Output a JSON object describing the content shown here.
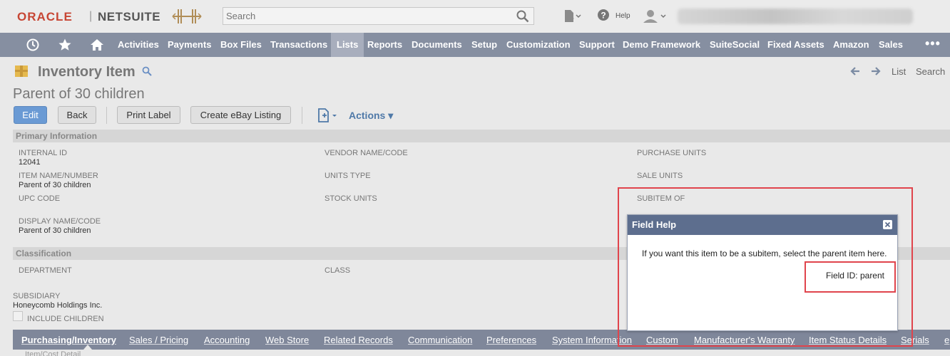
{
  "header": {
    "logo_oracle": "ORACLE",
    "logo_sep": "|",
    "logo_netsuite": "NETSUITE",
    "search_placeholder": "Search",
    "help_label": "Help"
  },
  "nav": {
    "items": [
      "Activities",
      "Payments",
      "Box Files",
      "Transactions",
      "Lists",
      "Reports",
      "Documents",
      "Setup",
      "Customization",
      "Support",
      "Demo Framework",
      "SuiteSocial",
      "Fixed Assets",
      "Amazon",
      "Sales"
    ],
    "active": "Lists",
    "more": "•••"
  },
  "page": {
    "title": "Inventory Item",
    "record_name": "Parent of 30 children",
    "pager_list": "List",
    "pager_search": "Search"
  },
  "buttons": {
    "edit": "Edit",
    "back": "Back",
    "print_label": "Print Label",
    "create_ebay": "Create eBay Listing",
    "actions": "Actions ▾"
  },
  "sections": {
    "primary": "Primary Information",
    "classification": "Classification"
  },
  "fields": {
    "internal_id_label": "INTERNAL ID",
    "internal_id_value": "12041",
    "item_name_label": "ITEM NAME/NUMBER",
    "item_name_value": "Parent of 30 children",
    "upc_label": "UPC CODE",
    "display_name_label": "DISPLAY NAME/CODE",
    "display_name_value": "Parent of 30 children",
    "vendor_label": "VENDOR NAME/CODE",
    "units_type_label": "UNITS TYPE",
    "stock_units_label": "STOCK UNITS",
    "purchase_units_label": "PURCHASE UNITS",
    "sale_units_label": "SALE UNITS",
    "subitem_label": "SUBITEM OF",
    "department_label": "DEPARTMENT",
    "class_label": "CLASS",
    "subsidiary_label": "SUBSIDIARY",
    "subsidiary_value": "Honeycomb Holdings Inc.",
    "include_children_label": "INCLUDE CHILDREN"
  },
  "tabs": {
    "items": [
      "Purchasing/Inventory",
      "Sales / Pricing",
      "Accounting",
      "Web Store",
      "Related Records",
      "Communication",
      "Preferences",
      "System Information",
      "Custom",
      "Manufacturer's Warranty",
      "Item Status Details",
      "Serials",
      "e"
    ],
    "active": "Purchasing/Inventory",
    "subtab_fragment": "Item/Cost Detail"
  },
  "popup": {
    "title": "Field Help",
    "body": "If you want this item to be a subitem, select the parent item here.",
    "field_id": "Field ID: parent"
  },
  "colors": {
    "nav_bg": "#868fa1",
    "popup_header": "#5d6e8e",
    "highlight": "#e0444c",
    "primary_button": "#6a9ad4"
  }
}
